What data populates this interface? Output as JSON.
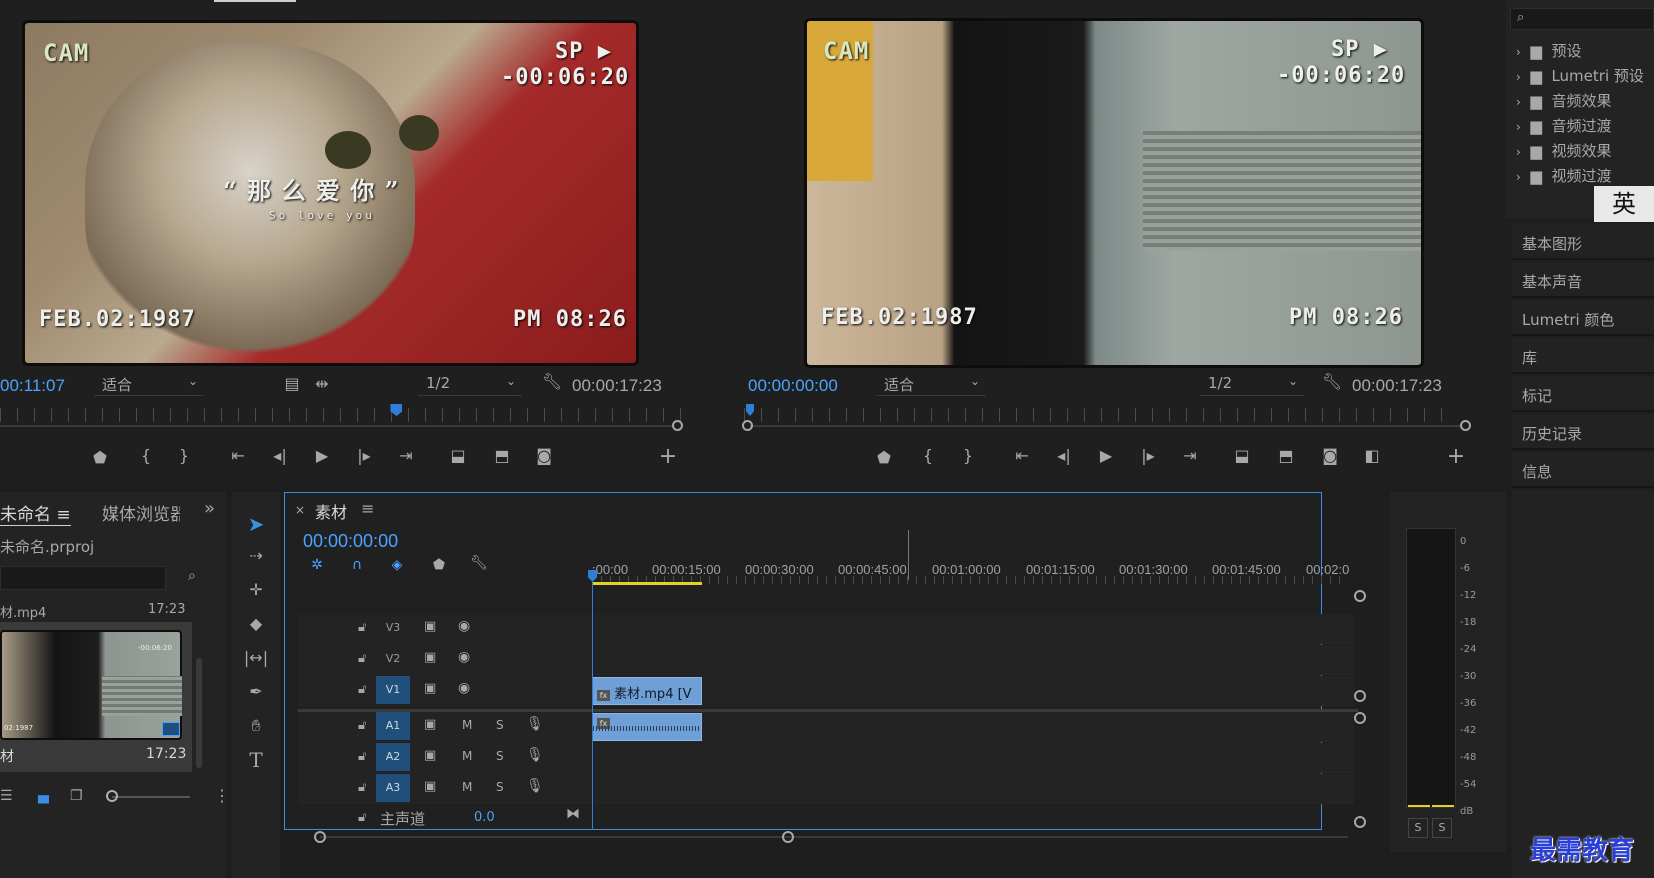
{
  "source_monitor": {
    "osd": {
      "cam": "CAM",
      "sp": "SP ▶",
      "counter": "-00:06:20",
      "date": "FEB.02:1987",
      "time": "PM 08:26"
    },
    "subtitle_main": "“ 那 么 爱 你 ”",
    "subtitle_sub": "So love you",
    "timecode": "00:11:07",
    "fit": "适合",
    "resolution": "1/2",
    "duration": "00:00:17:23",
    "playhead_fraction": 0.59
  },
  "program_monitor": {
    "osd": {
      "cam": "CAM",
      "sp": "SP ▶",
      "counter": "-00:06:20",
      "date": "FEB.02:1987",
      "time": "PM 08:26"
    },
    "timecode": "00:00:00:00",
    "fit": "适合",
    "resolution": "1/2",
    "duration": "00:00:17:23",
    "playhead_fraction": 0.0
  },
  "effects_panel": {
    "search_icon": "search-icon",
    "folders": [
      {
        "label": "预设"
      },
      {
        "label": "Lumetri 预设"
      },
      {
        "label": "音频效果"
      },
      {
        "label": "音频过渡"
      },
      {
        "label": "视频效果"
      },
      {
        "label": "视频过渡"
      }
    ],
    "ime_char": "英"
  },
  "right_panels": [
    "基本图形",
    "基本声音",
    "Lumetri 颜色",
    "库",
    "标记",
    "历史记录",
    "信息"
  ],
  "project": {
    "tab_label": "未命名",
    "tab2_label": "媒体浏览器",
    "file_name": "未命名.prproj",
    "item_top_name": "材.mp4",
    "item_top_duration": "17:23",
    "item_name": "材",
    "item_duration": "17:23",
    "thumb_overlay_counter": "-00:06:20",
    "thumb_overlay_date": "02:1987"
  },
  "timeline": {
    "tab_label": "素材",
    "timecode": "00:00:00:00",
    "ruler_labels": [
      ":00:00",
      "00:00:15:00",
      "00:00:30:00",
      "00:00:45:00",
      "00:01:00:00",
      "00:01:15:00",
      "00:01:30:00",
      "00:01:45:00",
      "00:02:0"
    ],
    "video_tracks": [
      "V3",
      "V2",
      "V1"
    ],
    "audio_tracks": [
      "A1",
      "A2",
      "A3"
    ],
    "mute_label": "M",
    "solo_label": "S",
    "clip_label": "素材.mp4 [V",
    "master_label": "主声道",
    "master_value": "0.0"
  },
  "audio_meter": {
    "labels": [
      "0",
      "-6",
      "-12",
      "-18",
      "-24",
      "-30",
      "-36",
      "-42",
      "-48",
      "-54",
      "dB"
    ],
    "solo_left": "S",
    "solo_right": "S"
  },
  "watermark": "最需教育",
  "colors": {
    "accent": "#3b8ee0",
    "timecode_blue": "#4aa3ff",
    "playhead": "#2f7fd9",
    "clip": "#6e9fd6",
    "track_on": "#1f4f7a",
    "bg": "#1e1e1e",
    "panel": "#232323"
  }
}
